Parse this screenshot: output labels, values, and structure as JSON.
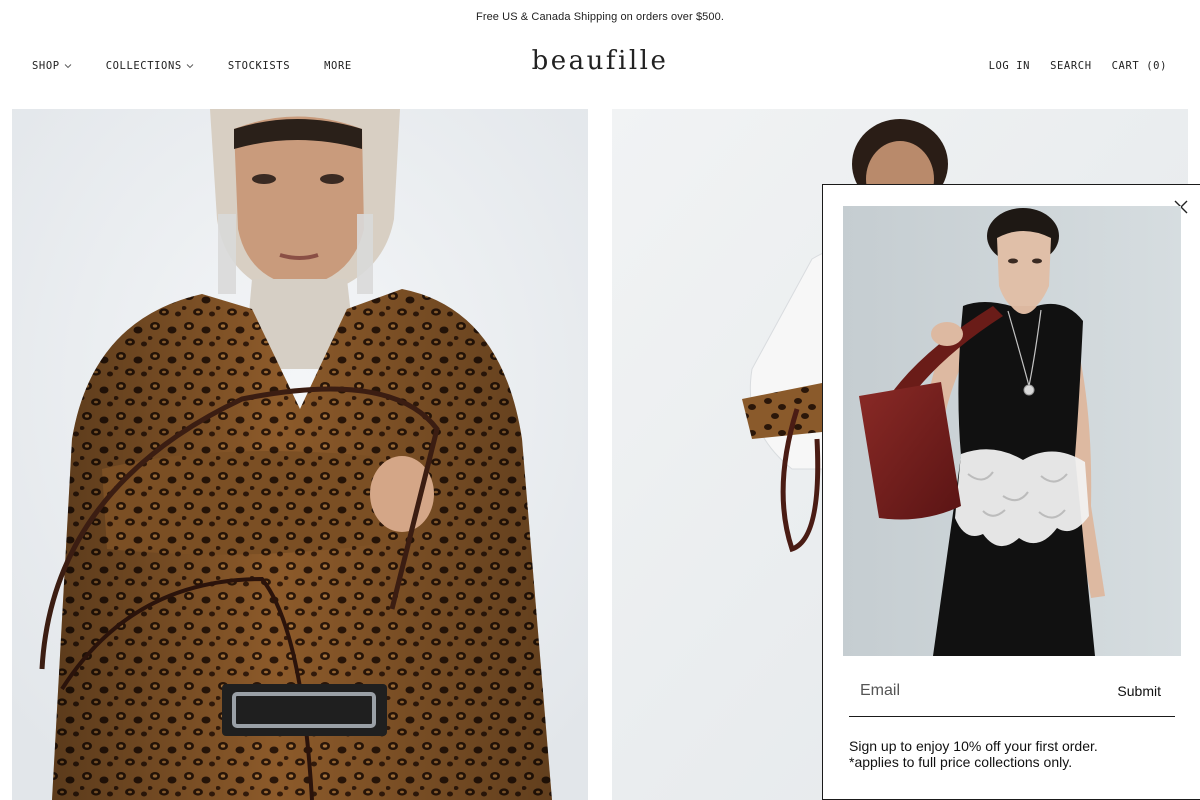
{
  "announcement": {
    "text": "Free US & Canada Shipping on orders over $500."
  },
  "header": {
    "logo": "beaufille",
    "nav_left": [
      {
        "label": "SHOP",
        "has_dropdown": true
      },
      {
        "label": "COLLECTIONS",
        "has_dropdown": true
      },
      {
        "label": "STOCKISTS",
        "has_dropdown": false
      },
      {
        "label": "MORE",
        "has_dropdown": false
      }
    ],
    "nav_right": {
      "login": "LOG IN",
      "search": "SEARCH",
      "cart": "CART (0)"
    }
  },
  "popup": {
    "email_placeholder": "Email",
    "submit_label": "Submit",
    "line1": "Sign up to enjoy 10% off your first order.",
    "line2": "*applies to full price collections only."
  },
  "colors": {
    "text": "#1a1a1a",
    "background": "#ffffff",
    "leopard_base": "#8a5a2b",
    "bag_red": "#7a1f1f",
    "dress_black": "#111111"
  }
}
